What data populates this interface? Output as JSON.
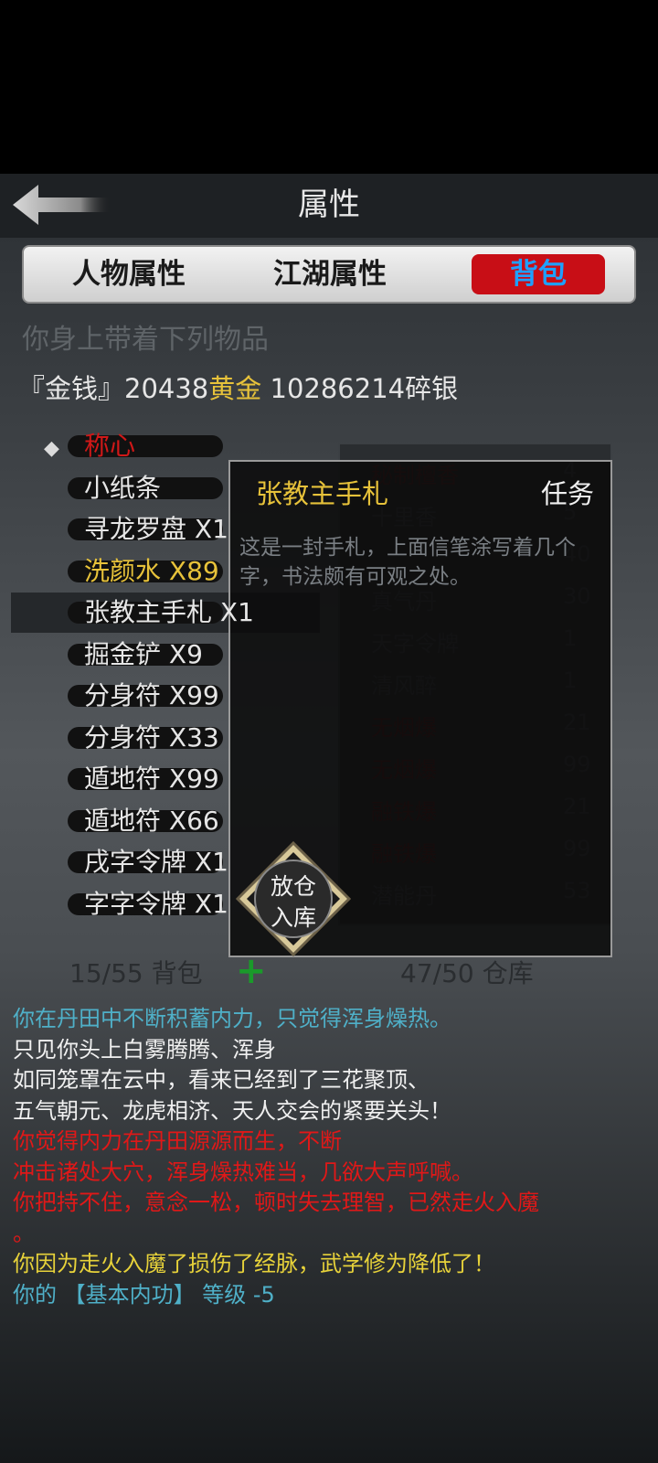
{
  "header": {
    "title": "属性"
  },
  "tabs": [
    {
      "label": "人物属性"
    },
    {
      "label": "江湖属性"
    },
    {
      "label": "背包",
      "active": true
    }
  ],
  "inventory": {
    "heading": "你身上带着下列物品",
    "money_prefix": "『金钱』20438",
    "money_gold": "黄金",
    "money_suffix": " 10286214碎银",
    "items": [
      {
        "label": "称心",
        "color": "#d01818"
      },
      {
        "label": "小纸条",
        "color": "#e6e6e6"
      },
      {
        "label": "寻龙罗盘 X1",
        "color": "#e6e6e6"
      },
      {
        "label": "洗颜水 X89",
        "color": "#e7c23a"
      },
      {
        "label": "张教主手札 X1",
        "color": "#e6e6e6"
      },
      {
        "label": "掘金铲 X9",
        "color": "#e6e6e6"
      },
      {
        "label": "分身符 X99",
        "color": "#e6e6e6"
      },
      {
        "label": "分身符 X33",
        "color": "#e6e6e6"
      },
      {
        "label": "遁地符 X99",
        "color": "#e6e6e6"
      },
      {
        "label": "遁地符 X66",
        "color": "#e6e6e6"
      },
      {
        "label": "戌字令牌 X1",
        "color": "#e6e6e6"
      },
      {
        "label": "字字令牌 X1",
        "color": "#e6e6e6"
      }
    ],
    "bag_count": "15/55 背包",
    "add_symbol": "+",
    "warehouse_count": "47/50 仓库"
  },
  "warehouse": {
    "items": [
      {
        "label": "秘制檀香",
        "value": "4",
        "color": "#5a2020"
      },
      {
        "label": "十里香",
        "value": "5",
        "color": "#3f4448"
      },
      {
        "label": "",
        "value": "40",
        "color": "#3f4448"
      },
      {
        "label": "真气丹",
        "value": "30",
        "color": "#3f4448"
      },
      {
        "label": "天字令牌",
        "value": "1",
        "color": "#3f4448"
      },
      {
        "label": "清风醉",
        "value": "1",
        "color": "#3f4448"
      },
      {
        "label": "无烟爆",
        "value": "21",
        "color": "#5a1818"
      },
      {
        "label": "无烟爆",
        "value": "99",
        "color": "#5a1818"
      },
      {
        "label": "融铁爆",
        "value": "21",
        "color": "#5a1818"
      },
      {
        "label": "融铁爆",
        "value": "99",
        "color": "#5a1818"
      },
      {
        "label": "潜能丹",
        "value": "53",
        "color": "#3f4448"
      }
    ]
  },
  "popup": {
    "item_name": "张教主手札",
    "item_type": "任务",
    "description": "这是一封手札，上面信笔涂写着几个字，书法颇有可观之处。",
    "store_button_line1": "放仓",
    "store_button_line2": "入库"
  },
  "log": [
    {
      "text": "你在丹田中不断积蓄内力，只觉得浑身燥热。",
      "color": "#4fb0c8"
    },
    {
      "text": "只见你头上白雾腾腾、浑身",
      "color": "#f0f0f0"
    },
    {
      "text": "如同笼罩在云中，看来已经到了三花聚顶、",
      "color": "#f0f0f0"
    },
    {
      "text": "五气朝元、龙虎相济、天人交会的紧要关头！",
      "color": "#f0f0f0"
    },
    {
      "text": "你觉得内力在丹田源源而生，不断",
      "color": "#e01818"
    },
    {
      "text": "冲击诸处大穴，浑身燥热难当，几欲大声呼喊。",
      "color": "#e01818"
    },
    {
      "text": "你把持不住，意念一松，顿时失去理智，已然走火入魔",
      "color": "#e01818"
    },
    {
      "text": "。",
      "color": "#e01818"
    },
    {
      "text": "你因为走火入魔了损伤了经脉，武学修为降低了！",
      "color": "#e7d23a"
    },
    {
      "text": "你的 【基本内功】 等级 -5",
      "color": "#4fb0c8"
    }
  ],
  "icons": {
    "back": "back-arrow-icon",
    "selected": "diamond-icon"
  }
}
